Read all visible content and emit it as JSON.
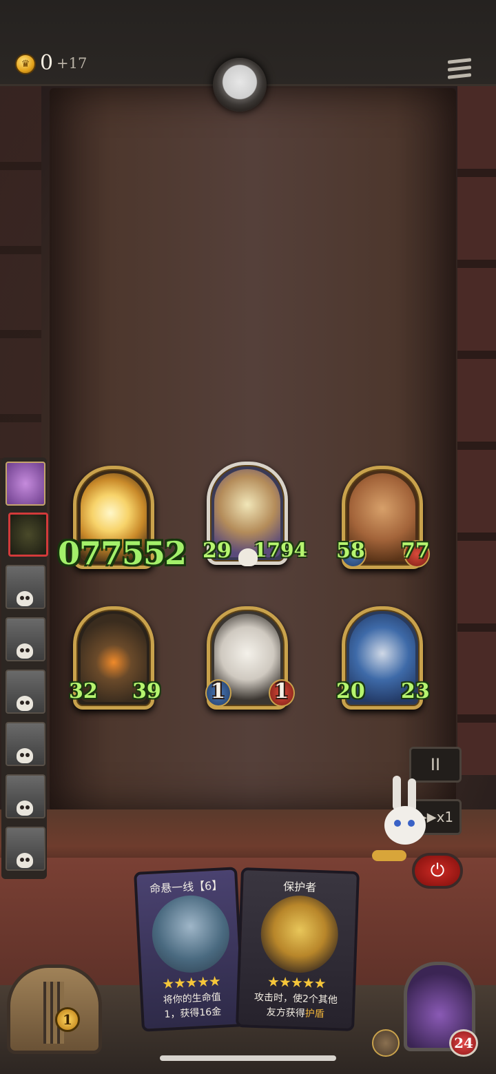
{
  "topbar": {
    "gold": "0",
    "gold_income": "+17",
    "coin_icon": "crown-coin-icon",
    "menu_icon": "menu-icon"
  },
  "opponents": {
    "list": [
      "purple-dragon",
      "shadow-demon",
      "defeated-1",
      "defeated-2",
      "defeated-3",
      "defeated-4",
      "defeated-5",
      "defeated-6"
    ],
    "current_index": 1
  },
  "floating_damage": "077552",
  "board": {
    "top_row": [
      {
        "name": "explosion-minion",
        "attack": "",
        "health": ""
      },
      {
        "name": "dwarf-warrior",
        "attack": "29",
        "health": "1794"
      },
      {
        "name": "treant",
        "attack": "58",
        "health": "77"
      }
    ],
    "bottom_row": [
      {
        "name": "dark-tree",
        "attack": "32",
        "health": "39"
      },
      {
        "name": "cow-minion",
        "attack": "1",
        "health": "1"
      },
      {
        "name": "elf-sorceress",
        "attack": "20",
        "health": "23"
      }
    ]
  },
  "controls": {
    "pause": "II",
    "speed": "x1",
    "power_icon": "power-icon"
  },
  "hand": {
    "cards": [
      {
        "title": "命悬一线【6】",
        "stars": "★★★★★",
        "desc_line1": "将你的生命值",
        "desc_line2": "1，获得16金"
      },
      {
        "title": "保护者",
        "stars": "★★★★★",
        "desc_line1": "攻击时，使2个其他",
        "desc_line2_prefix": "友方获得",
        "desc_line2_hl": "护盾"
      }
    ]
  },
  "chest": {
    "count": "1"
  },
  "hero": {
    "health": "24"
  },
  "colors": {
    "stat_green": "#b6f56f",
    "gold_border": "#c9a24c",
    "power_red": "#cc2a24"
  }
}
